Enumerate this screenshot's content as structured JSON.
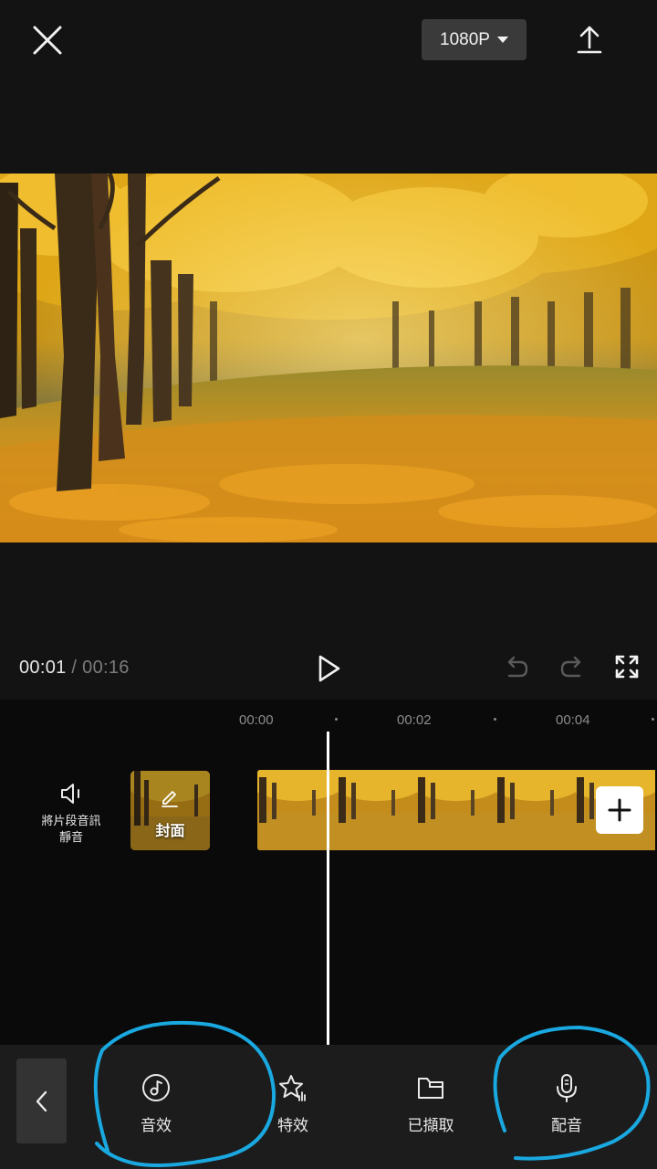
{
  "header": {
    "resolution_label": "1080P",
    "close_icon": "close-icon",
    "export_icon": "upload-icon"
  },
  "playback": {
    "current_time": "00:01",
    "separator": "/",
    "total_time": "00:16"
  },
  "timeline": {
    "ruler": [
      "00:00",
      "00:02",
      "00:04"
    ],
    "mute_label_line1": "將片段音訊",
    "mute_label_line2": "靜音",
    "cover_label": "封面",
    "add_icon": "plus-icon"
  },
  "toolbar": {
    "items": [
      {
        "label": "音效",
        "icon": "music-note-icon"
      },
      {
        "label": "特效",
        "icon": "sparkle-star-icon"
      },
      {
        "label": "已擷取",
        "icon": "folder-icon"
      },
      {
        "label": "配音",
        "icon": "microphone-icon"
      }
    ]
  },
  "colors": {
    "background": "#131313",
    "timeline_bg": "#0a0a0a",
    "toolbar_bg": "#1c1c1c",
    "annotation": "#1aa8e0",
    "autumn_gold": "#e8b320"
  }
}
